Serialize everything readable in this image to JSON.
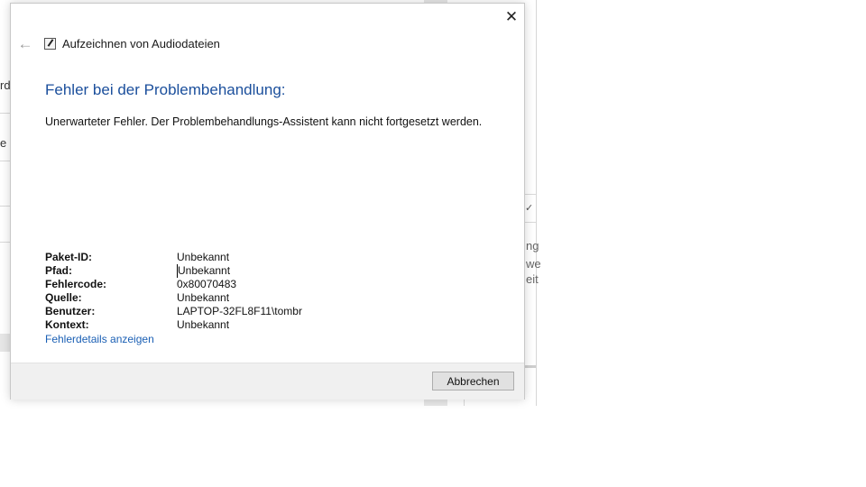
{
  "background": {
    "text_fragments": [
      "rd",
      "e",
      "ng",
      "we",
      "eit"
    ]
  },
  "dialog": {
    "title": "Aufzeichnen von Audiodateien",
    "heading": "Fehler bei der Problembehandlung:",
    "message": "Unerwarteter Fehler. Der Problembehandlungs-Assistent kann nicht fortgesetzt werden.",
    "details": [
      {
        "label": "Paket-ID:",
        "value": "Unbekannt"
      },
      {
        "label": "Pfad:",
        "value": "Unbekannt"
      },
      {
        "label": "Fehlercode:",
        "value": "0x80070483"
      },
      {
        "label": "Quelle:",
        "value": "Unbekannt"
      },
      {
        "label": "Benutzer:",
        "value": "LAPTOP-32FL8F11\\tombr"
      },
      {
        "label": "Kontext:",
        "value": "Unbekannt"
      }
    ],
    "details_link": "Fehlerdetails anzeigen",
    "cancel_label": "Abbrechen",
    "close_symbol": "✕",
    "back_symbol": "←"
  },
  "colors": {
    "heading": "#1b4f9c",
    "link": "#1a5fb4",
    "footer": "#f0f0f0"
  },
  "icons": {
    "close": "close-icon",
    "back": "back-arrow-icon",
    "title": "troubleshooter-icon"
  }
}
